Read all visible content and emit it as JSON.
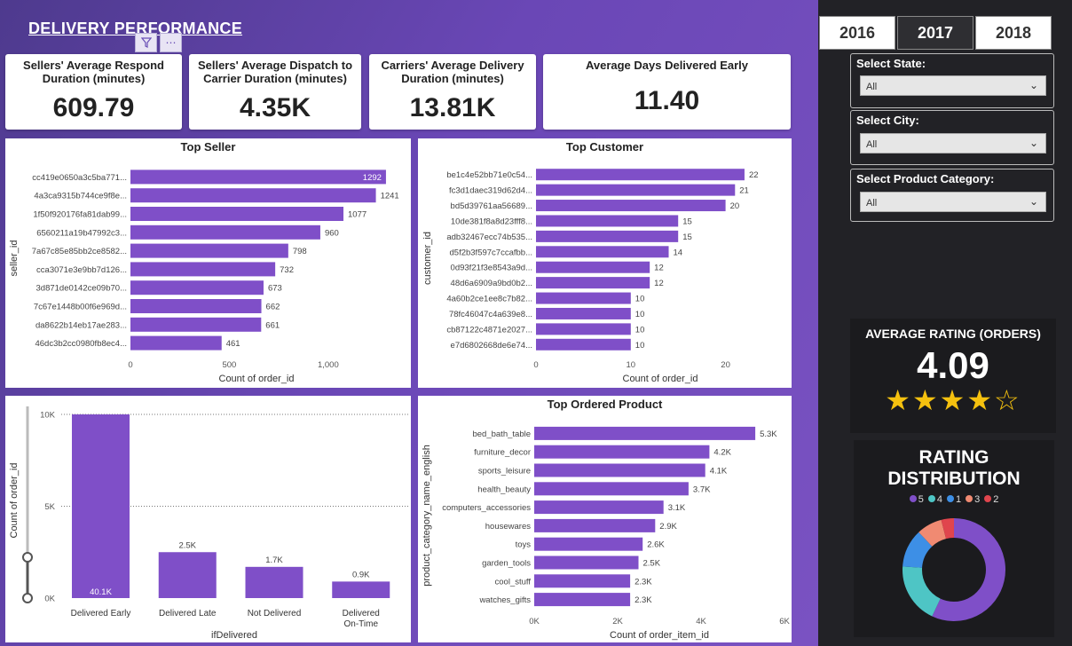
{
  "header": {
    "title": "DELIVERY PERFORMANCE",
    "filter_icon": "filter-icon",
    "more_icon": "more-icon"
  },
  "kpis": [
    {
      "label": "Sellers' Average Respond Duration (minutes)",
      "value": "609.79"
    },
    {
      "label": "Sellers' Average Dispatch to Carrier Duration (minutes)",
      "value": "4.35K"
    },
    {
      "label": "Carriers' Average Delivery Duration (minutes)",
      "value": "13.81K"
    },
    {
      "label": "Average Days Delivered Early",
      "value": "11.40"
    }
  ],
  "years": {
    "options": [
      "2016",
      "2017",
      "2018"
    ],
    "selected": "2017"
  },
  "filters": [
    {
      "label": "Select State:",
      "value": "All"
    },
    {
      "label": "Select City:",
      "value": "All"
    },
    {
      "label": "Select Product Category:",
      "value": "All"
    }
  ],
  "rating": {
    "title": "AVERAGE RATING (ORDERS)",
    "value": "4.09",
    "stars_filled": 4,
    "stars_total": 5
  },
  "distribution": {
    "title": "RATING DISTRIBUTION"
  },
  "colors": {
    "bar": "#7f4fc8",
    "accent": "#6a47b6",
    "star": "#f5c10f"
  },
  "chart_data": [
    {
      "id": "top-seller",
      "type": "bar",
      "orientation": "horizontal",
      "title": "Top Seller",
      "xlabel": "Count of order_id",
      "ylabel": "seller_id",
      "xlim": [
        0,
        1400
      ],
      "xticks": [
        "0",
        "500",
        "1,000"
      ],
      "xtick_values": [
        0,
        500,
        1000
      ],
      "categories": [
        "cc419e0650a3c5ba771...",
        "4a3ca9315b744ce9f8e...",
        "1f50f920176fa81dab99...",
        "6560211a19b47992c3...",
        "7a67c85e85bb2ce8582...",
        "cca3071e3e9bb7d126...",
        "3d871de0142ce09b70...",
        "7c67e1448b00f6e969d...",
        "da8622b14eb17ae283...",
        "46dc3b2cc0980fb8ec4..."
      ],
      "values": [
        1292,
        1241,
        1077,
        960,
        798,
        732,
        673,
        662,
        661,
        461
      ],
      "labels": [
        "1292",
        "1241",
        "1077",
        "960",
        "798",
        "732",
        "673",
        "662",
        "661",
        "461"
      ]
    },
    {
      "id": "top-customer",
      "type": "bar",
      "orientation": "horizontal",
      "title": "Top Customer",
      "xlabel": "Count of order_id",
      "ylabel": "customer_id",
      "xlim": [
        0,
        25
      ],
      "xticks": [
        "0",
        "10",
        "20"
      ],
      "xtick_values": [
        0,
        10,
        20
      ],
      "categories": [
        "be1c4e52bb71e0c54...",
        "fc3d1daec319d62d4...",
        "bd5d39761aa56689...",
        "10de381f8a8d23fff8...",
        "adb32467ecc74b535...",
        "d5f2b3f597c7ccafbb...",
        "0d93f21f3e8543a9d...",
        "48d6a6909a9bd0b2...",
        "4a60b2ce1ee8c7b82...",
        "78fc46047c4a639e8...",
        "cb87122c4871e2027...",
        "e7d6802668de6e74..."
      ],
      "values": [
        22,
        21,
        20,
        15,
        15,
        14,
        12,
        12,
        10,
        10,
        10,
        10
      ],
      "labels": [
        "22",
        "21",
        "20",
        "15",
        "15",
        "14",
        "12",
        "12",
        "10",
        "10",
        "10",
        "10"
      ]
    },
    {
      "id": "if-delivered",
      "type": "bar",
      "orientation": "vertical",
      "title": "",
      "xlabel": "ifDelivered",
      "ylabel": "Count of order_id",
      "ylim": [
        0,
        10000
      ],
      "yticks": [
        "0K",
        "5K",
        "10K"
      ],
      "ytick_values": [
        0,
        5000,
        10000
      ],
      "categories": [
        "Delivered Early",
        "Delivered Late",
        "Not Delivered",
        "Delivered On-Time"
      ],
      "values": [
        40100,
        2500,
        1700,
        900
      ],
      "labels": [
        "40.1K",
        "2.5K",
        "1.7K",
        "0.9K"
      ]
    },
    {
      "id": "top-product",
      "type": "bar",
      "orientation": "horizontal",
      "title": "Top Ordered Product",
      "xlabel": "Count of order_item_id",
      "ylabel": "product_category_name_english",
      "xlim": [
        0,
        6000
      ],
      "xticks": [
        "0K",
        "2K",
        "4K",
        "6K"
      ],
      "xtick_values": [
        0,
        2000,
        4000,
        6000
      ],
      "categories": [
        "bed_bath_table",
        "furniture_decor",
        "sports_leisure",
        "health_beauty",
        "computers_accessories",
        "housewares",
        "toys",
        "garden_tools",
        "cool_stuff",
        "watches_gifts"
      ],
      "values": [
        5300,
        4200,
        4100,
        3700,
        3100,
        2900,
        2600,
        2500,
        2300,
        2300
      ],
      "labels": [
        "5.3K",
        "4.2K",
        "4.1K",
        "3.7K",
        "3.1K",
        "2.9K",
        "2.6K",
        "2.5K",
        "2.3K",
        "2.3K"
      ]
    },
    {
      "id": "rating-distribution",
      "type": "pie",
      "title": "RATING DISTRIBUTION",
      "categories": [
        "5",
        "4",
        "1",
        "3",
        "2"
      ],
      "values": [
        57,
        19,
        12,
        8,
        4
      ],
      "colors": [
        "#7f4fc8",
        "#4ec5c5",
        "#3d8fe6",
        "#f08a72",
        "#e0454d"
      ]
    }
  ]
}
